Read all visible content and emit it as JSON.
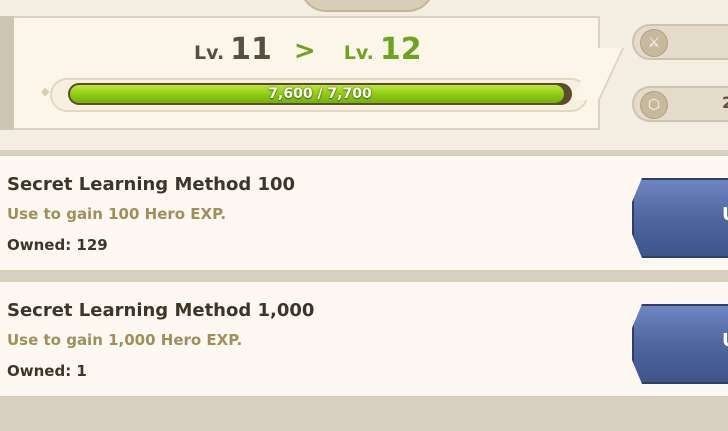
{
  "level": {
    "current_prefix": "Lv.",
    "current": "11",
    "arrow": ">",
    "next_prefix": "Lv.",
    "next": "12"
  },
  "exp": {
    "text": "7,600 / 7,700",
    "fraction": 0.987
  },
  "side": {
    "buttons": [
      {
        "icon": "sword-emblem-icon",
        "text": ""
      },
      {
        "icon": "shield-hex-icon",
        "text": "2"
      }
    ]
  },
  "items": [
    {
      "name": "Secret Learning Method 100",
      "desc": "Use to gain 100 Hero EXP.",
      "owned": "Owned: 129",
      "button": "U"
    },
    {
      "name": "Secret Learning Method 1,000",
      "desc": "Use to gain 1,000 Hero EXP.",
      "owned": "Owned: 1",
      "button": "U"
    }
  ],
  "colors": {
    "accent_green": "#6aa51b",
    "button_blue": "#50669f",
    "desc_gold": "#a08f58"
  }
}
